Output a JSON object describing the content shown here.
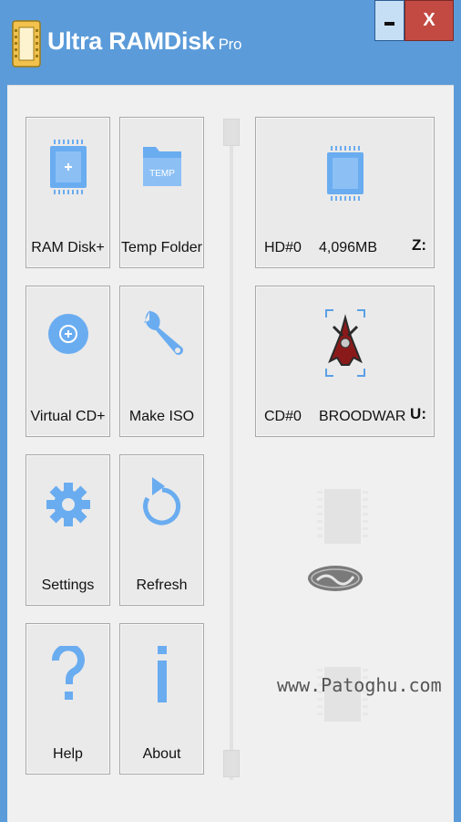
{
  "window": {
    "title": "Ultra RAMDisk",
    "title_suffix": "Pro",
    "minimize_symbol": "▬",
    "close_symbol": "X"
  },
  "tiles": [
    {
      "label": "RAM Disk+",
      "icon": "ram-disk-add-icon"
    },
    {
      "label": "Temp Folder",
      "icon": "temp-folder-icon",
      "icon_text": "TEMP"
    },
    {
      "label": "Virtual CD+",
      "icon": "virtual-cd-add-icon"
    },
    {
      "label": "Make ISO",
      "icon": "wrench-icon"
    },
    {
      "label": "Settings",
      "icon": "gear-icon"
    },
    {
      "label": "Refresh",
      "icon": "refresh-icon"
    },
    {
      "label": "Help",
      "icon": "question-icon"
    },
    {
      "label": "About",
      "icon": "info-icon"
    }
  ],
  "drives": [
    {
      "id": "HD#0",
      "info": "4,096MB",
      "letter": "Z:",
      "icon": "ram-drive-icon"
    },
    {
      "id": "CD#0",
      "info": "BROODWAR",
      "letter": "U:",
      "icon": "game-disc-icon"
    }
  ],
  "watermark": {
    "text": "www.Patoghu.com"
  },
  "colors": {
    "accent": "#6aacf0",
    "titlebar": "#5b9bd9",
    "close": "#c24a42",
    "panel": "#f0f0f0"
  }
}
